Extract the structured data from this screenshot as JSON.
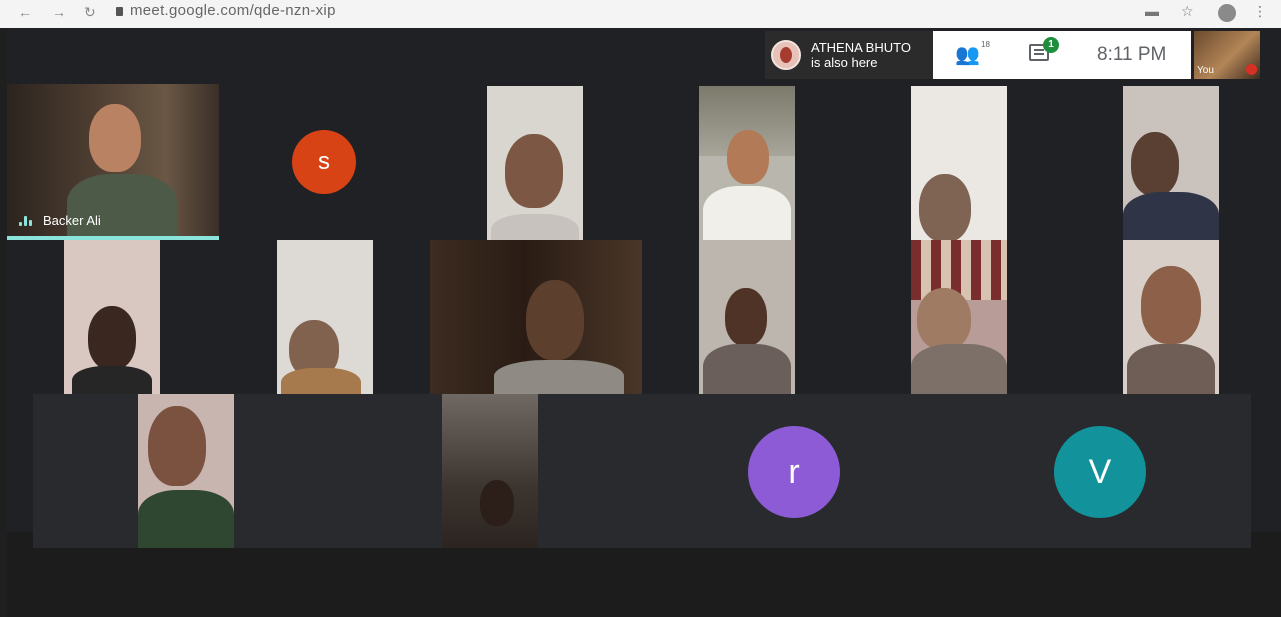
{
  "browser": {
    "url": "meet.google.com/qde-nzn-xip"
  },
  "presence": {
    "name": "ATHENA BHUTO",
    "status": "is also here"
  },
  "toolbar": {
    "participant_count": "18",
    "chat_badge": "1",
    "time": "8:11 PM",
    "self_label": "You"
  },
  "participants": {
    "active_speaker_name": "Backer Ali",
    "avatar_s": "s",
    "avatar_r": "r",
    "avatar_v": "V"
  },
  "colors": {
    "avatar_s": "#d84315",
    "avatar_r": "#8e5bd6",
    "avatar_v": "#12939c",
    "speaking": "#8ae4dc"
  }
}
